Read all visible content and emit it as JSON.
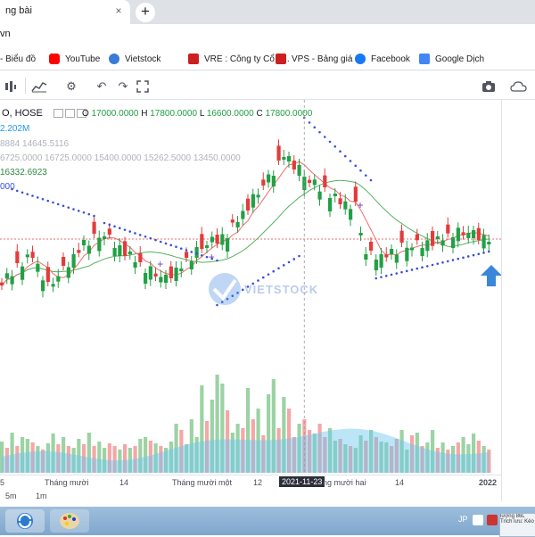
{
  "browser": {
    "tab_title": "ng bài",
    "close_label": "×",
    "new_tab_label": "+",
    "url": "vn"
  },
  "bookmarks": [
    {
      "label": "- Biểu đồ",
      "icon": "chart-icon",
      "color": "#2b62c9"
    },
    {
      "label": "YouTube",
      "icon": "youtube-icon",
      "color": "#ff0000"
    },
    {
      "label": "Vietstock",
      "icon": "vietstock-icon",
      "color": "#3a7bd5"
    },
    {
      "label": "VRE : Công ty Cổ p...",
      "icon": "vre-icon",
      "color": "#cc1f1f"
    },
    {
      "label": "VPS - Bảng giá",
      "icon": "vps-icon",
      "color": "#cc1f1f"
    },
    {
      "label": "Facebook",
      "icon": "facebook-icon",
      "color": "#1877f2"
    },
    {
      "label": "Google Dịch",
      "icon": "google-translate-icon",
      "color": "#4285f4"
    }
  ],
  "legend": {
    "symbol": "O, HOSE",
    "open_label": "O",
    "open": "17000.0000",
    "high_label": "H",
    "high": "17800.0000",
    "low_label": "L",
    "low": "16600.0000",
    "close_label": "C",
    "close": "17800.0000",
    "volume": "2.202M",
    "ind1": "8884  14645.5116",
    "ind2": "6725.0000  16725.0000  15400.0000  15262.5000  13450.0000",
    "ma": "16332.6923",
    "sar": "000"
  },
  "watermark": "VIETSTOCK",
  "time_axis": {
    "labels": [
      "5",
      "Tháng mười",
      "14",
      "Tháng mười một",
      "12",
      "2021-11-23",
      "ng mười hai",
      "14",
      "2022"
    ]
  },
  "range_buttons": [
    "5m",
    "1m"
  ],
  "taskbar": {
    "lang": "JP",
    "popup_text": "lượng 86L Trích lưu: Kéo"
  },
  "colors": {
    "up": "#22a046",
    "down": "#e23c3c",
    "ma_red": "#f26b6b",
    "ma_green": "#57b15f",
    "sar": "#3b4fd6",
    "volume_area": "#6bc6f0",
    "arrow": "#3a87d9"
  },
  "chart_data": {
    "type": "candlestick",
    "symbol": "O, HOSE",
    "volume": {
      "values": [
        35,
        28,
        45,
        30,
        40,
        38,
        34,
        30,
        26,
        33,
        44,
        32,
        40,
        30,
        28,
        38,
        32,
        45,
        30,
        35,
        28,
        33,
        30,
        26,
        32,
        28,
        30,
        38,
        40,
        36,
        33,
        30,
        28,
        35,
        55,
        48,
        32,
        60,
        40,
        98,
        58,
        82,
        110,
        100,
        70,
        45,
        55,
        50,
        95,
        60,
        72,
        42,
        88,
        105,
        50,
        85,
        72,
        40,
        55,
        60,
        48,
        44,
        55,
        40,
        50,
        36,
        38,
        32,
        30,
        28,
        42,
        36,
        48,
        40,
        35,
        34,
        30,
        38,
        48,
        26,
        42,
        45,
        30,
        34,
        48,
        28,
        34,
        26,
        30,
        34,
        40,
        32,
        44,
        36,
        30,
        26
      ],
      "up": [
        1,
        0,
        1,
        0,
        1,
        1,
        0,
        1,
        0,
        1,
        1,
        0,
        1,
        0,
        1,
        1,
        0,
        1,
        0,
        1,
        1,
        0,
        0,
        1,
        0,
        1,
        0,
        1,
        1,
        0,
        1,
        0,
        1,
        1,
        1,
        0,
        1,
        1,
        1,
        1,
        0,
        1,
        1,
        1,
        0,
        1,
        1,
        0,
        1,
        0,
        1,
        0,
        1,
        1,
        0,
        1,
        0,
        0,
        1,
        0,
        0,
        1,
        0,
        0,
        1,
        1,
        0,
        1,
        0,
        1,
        1,
        0,
        1,
        0,
        1,
        1,
        0,
        0,
        1,
        1,
        0,
        1,
        0,
        1,
        1,
        0,
        1,
        0,
        1,
        0,
        1,
        1,
        1,
        0,
        1,
        0
      ]
    }
  }
}
